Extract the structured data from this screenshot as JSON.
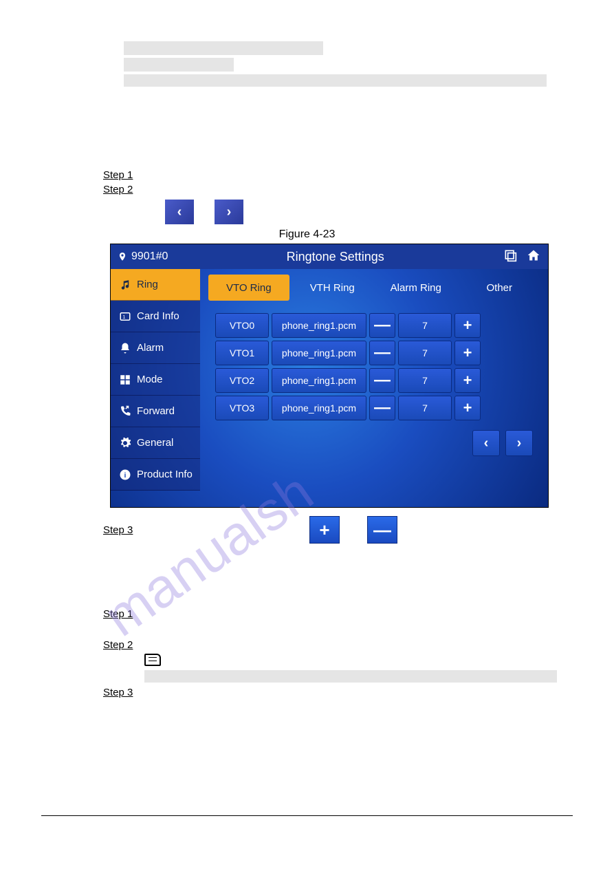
{
  "steps": {
    "step1": {
      "label": "Step 1"
    },
    "step2": {
      "label": "Step 2"
    },
    "step3": {
      "label": "Step 3"
    },
    "step1b": {
      "label": "Step 1"
    },
    "step2b": {
      "label": "Step 2"
    },
    "step3b": {
      "label": "Step 3"
    }
  },
  "arrows": {
    "left": "‹",
    "right": "›"
  },
  "symbols": {
    "plus": "+",
    "minus": "—"
  },
  "figure": {
    "caption": "Figure 4-23"
  },
  "screen": {
    "device_id": "9901#0",
    "title": "Ringtone Settings",
    "sidebar": [
      "Ring",
      "Card Info",
      "Alarm",
      "Mode",
      "Forward",
      "General",
      "Product Info"
    ],
    "tabs": [
      "VTO Ring",
      "VTH Ring",
      "Alarm Ring",
      "Other"
    ],
    "rows": [
      {
        "name": "VTO0",
        "file": "phone_ring1.pcm",
        "volume": "7"
      },
      {
        "name": "VTO1",
        "file": "phone_ring1.pcm",
        "volume": "7"
      },
      {
        "name": "VTO2",
        "file": "phone_ring1.pcm",
        "volume": "7"
      },
      {
        "name": "VTO3",
        "file": "phone_ring1.pcm",
        "volume": "7"
      }
    ]
  }
}
